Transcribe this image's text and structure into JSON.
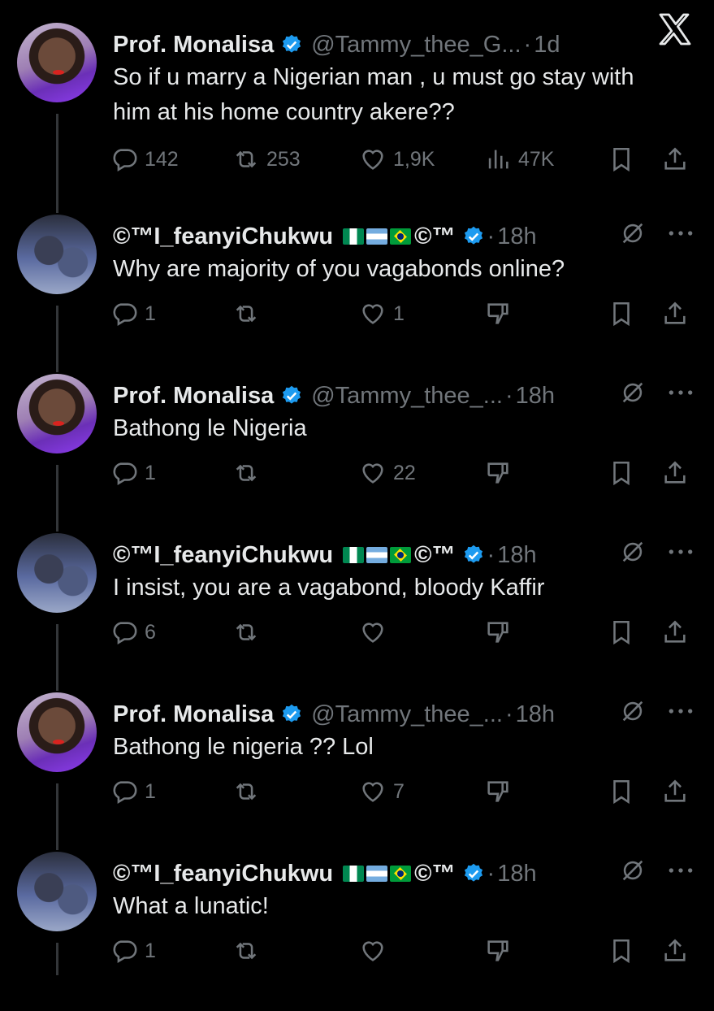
{
  "tweets": [
    {
      "name": "Prof. Monalisa",
      "handle": "@Tammy_thee_G...",
      "time": "1d",
      "text": "So if u marry a Nigerian man , u must go stay with him at his home country akere??",
      "stats": {
        "replies": "142",
        "retweets": "253",
        "likes": "1,9K",
        "views": "47K"
      }
    },
    {
      "name": "©™I_feanyiChukwu",
      "suffix": "©™",
      "time": "18h",
      "text": "Why are majority of you vagabonds online?",
      "stats": {
        "replies": "1",
        "retweets": "",
        "likes": "1"
      }
    },
    {
      "name": "Prof. Monalisa",
      "handle": "@Tammy_thee_...",
      "time": "18h",
      "text": "Bathong le Nigeria",
      "stats": {
        "replies": "1",
        "retweets": "",
        "likes": "22"
      }
    },
    {
      "name": "©™I_feanyiChukwu",
      "suffix": "©™",
      "time": "18h",
      "text": "I insist, you are a vagabond, bloody Kaffir",
      "stats": {
        "replies": "6",
        "retweets": "",
        "likes": ""
      }
    },
    {
      "name": "Prof. Monalisa",
      "handle": "@Tammy_thee_...",
      "time": "18h",
      "text": "Bathong le nigeria ?? Lol",
      "stats": {
        "replies": "1",
        "retweets": "",
        "likes": "7"
      }
    },
    {
      "name": "©™I_feanyiChukwu",
      "suffix": "©™",
      "time": "18h",
      "text": "What a lunatic!",
      "stats": {
        "replies": "1",
        "retweets": "",
        "likes": ""
      }
    }
  ],
  "icons": {
    "platform": "x-logo-icon",
    "verified": "verified-badge-icon",
    "muted": "muted-icon",
    "more": "more-icon"
  },
  "colors": {
    "background": "#000000",
    "text": "#e7e9ea",
    "muted": "#71767b",
    "verified": "#1d9bf0"
  }
}
